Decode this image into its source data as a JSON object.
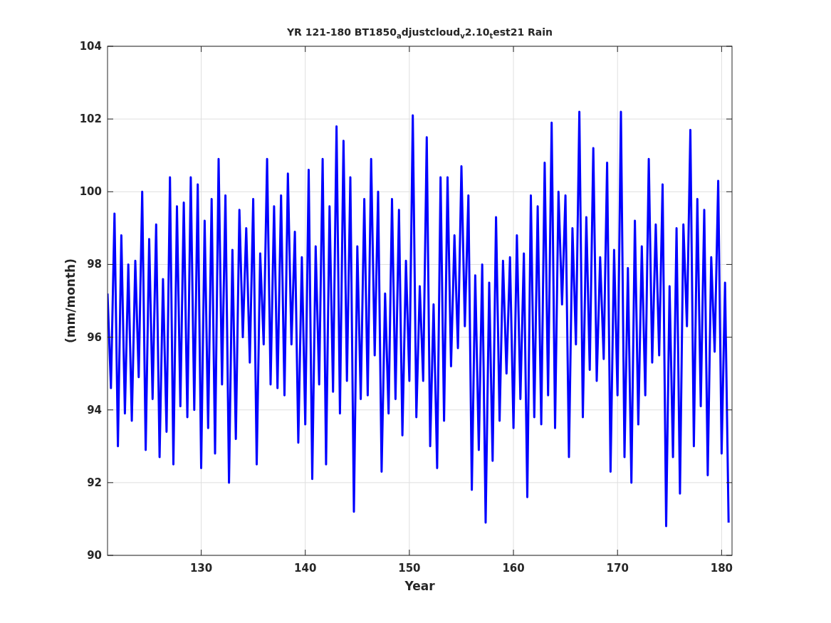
{
  "figure": {
    "chart_data": {
      "type": "line",
      "title": "YR 121-180 BT1850$_{a}$djustcloud$_{v}$2.10$_{t}$est21 Rain",
      "xlabel": "Year",
      "ylabel": "(mm/month)",
      "xlim": [
        121,
        181
      ],
      "grid": true,
      "x": [
        121,
        121.33,
        121.67,
        122,
        122.33,
        122.67,
        123,
        123.33,
        123.67,
        124,
        124.33,
        124.67,
        125,
        125.33,
        125.67,
        126,
        126.33,
        126.67,
        127,
        127.33,
        127.67,
        128,
        128.33,
        128.67,
        129,
        129.33,
        129.67,
        130,
        130.33,
        130.67,
        131,
        131.33,
        131.67,
        132,
        132.33,
        132.67,
        133,
        133.33,
        133.67,
        134,
        134.33,
        134.67,
        135,
        135.33,
        135.67,
        136,
        136.33,
        136.67,
        137,
        137.33,
        137.67,
        138,
        138.33,
        138.67,
        139,
        139.33,
        139.67,
        140,
        140.33,
        140.67,
        141,
        141.33,
        141.67,
        142,
        142.33,
        142.67,
        143,
        143.33,
        143.67,
        144,
        144.33,
        144.67,
        145,
        145.33,
        145.67,
        146,
        146.33,
        146.67,
        147,
        147.33,
        147.67,
        148,
        148.33,
        148.67,
        149,
        149.33,
        149.67,
        150,
        150.33,
        150.67,
        151,
        151.33,
        151.67,
        152,
        152.33,
        152.67,
        153,
        153.33,
        153.67,
        154,
        154.33,
        154.67,
        155,
        155.33,
        155.67,
        156,
        156.33,
        156.67,
        157,
        157.33,
        157.67,
        158,
        158.33,
        158.67,
        159,
        159.33,
        159.67,
        160,
        160.33,
        160.67,
        161,
        161.33,
        161.67,
        162,
        162.33,
        162.67,
        163,
        163.33,
        163.67,
        164,
        164.33,
        164.67,
        165,
        165.33,
        165.67,
        166,
        166.33,
        166.67,
        167,
        167.33,
        167.67,
        168,
        168.33,
        168.67,
        169,
        169.33,
        169.67,
        170,
        170.33,
        170.67,
        171,
        171.33,
        171.67,
        172,
        172.33,
        172.67,
        173,
        173.33,
        173.67,
        174,
        174.33,
        174.67,
        175,
        175.33,
        175.67,
        176,
        176.33,
        176.67,
        177,
        177.33,
        177.67,
        178,
        178.33,
        178.67,
        179,
        179.33,
        179.67,
        180,
        180.33,
        180.67
      ],
      "ylim": [
        90,
        104
      ],
      "xticks": [
        130,
        140,
        150,
        160,
        170,
        180
      ],
      "yticks": [
        90,
        92,
        94,
        96,
        98,
        100,
        102,
        104
      ],
      "series": [
        {
          "color": "#0000ff",
          "values": [
            97.2,
            94.6,
            99.4,
            93.0,
            98.8,
            93.9,
            98.0,
            93.7,
            98.1,
            94.9,
            100.0,
            92.9,
            98.7,
            94.3,
            99.1,
            92.7,
            97.6,
            93.4,
            100.4,
            92.5,
            99.6,
            94.1,
            99.7,
            93.8,
            100.4,
            94.0,
            100.2,
            92.4,
            99.2,
            93.5,
            99.8,
            92.8,
            100.9,
            94.7,
            99.9,
            92.0,
            98.4,
            93.2,
            99.5,
            96.0,
            99.0,
            95.3,
            99.8,
            92.5,
            98.3,
            95.8,
            100.9,
            94.7,
            99.6,
            94.6,
            99.9,
            94.4,
            100.5,
            95.8,
            98.9,
            93.1,
            98.2,
            93.6,
            100.6,
            92.1,
            98.5,
            94.7,
            100.9,
            92.5,
            99.6,
            94.5,
            101.8,
            93.9,
            101.4,
            94.8,
            100.4,
            91.2,
            98.5,
            94.3,
            99.8,
            94.4,
            100.9,
            95.5,
            100.0,
            92.3,
            97.2,
            93.9,
            99.8,
            94.3,
            99.5,
            93.3,
            98.1,
            94.8,
            102.1,
            93.8,
            97.4,
            94.8,
            101.5,
            93.0,
            96.9,
            92.4,
            100.4,
            93.7,
            100.4,
            95.2,
            98.8,
            95.7,
            100.7,
            96.3,
            99.9,
            91.8,
            97.7,
            92.9,
            98.0,
            90.9,
            97.5,
            92.6,
            99.3,
            93.7,
            98.1,
            95.0,
            98.2,
            93.5,
            98.8,
            94.3,
            98.3,
            91.6,
            99.9,
            93.8,
            99.6,
            93.6,
            100.8,
            94.4,
            101.9,
            93.5,
            100.0,
            96.9,
            99.9,
            92.7,
            99.0,
            95.8,
            102.2,
            93.8,
            99.3,
            95.1,
            101.2,
            94.8,
            98.2,
            95.4,
            100.8,
            92.3,
            98.4,
            94.4,
            102.2,
            92.7,
            97.9,
            92.0,
            99.2,
            93.6,
            98.5,
            94.4,
            100.9,
            95.3,
            99.1,
            95.5,
            100.2,
            90.8,
            97.4,
            92.7,
            99.0,
            91.7,
            99.1,
            96.3,
            101.7,
            93.0,
            99.8,
            94.1,
            99.5,
            92.2,
            98.2,
            95.6,
            100.3,
            92.8,
            97.5,
            90.9
          ]
        }
      ]
    }
  }
}
